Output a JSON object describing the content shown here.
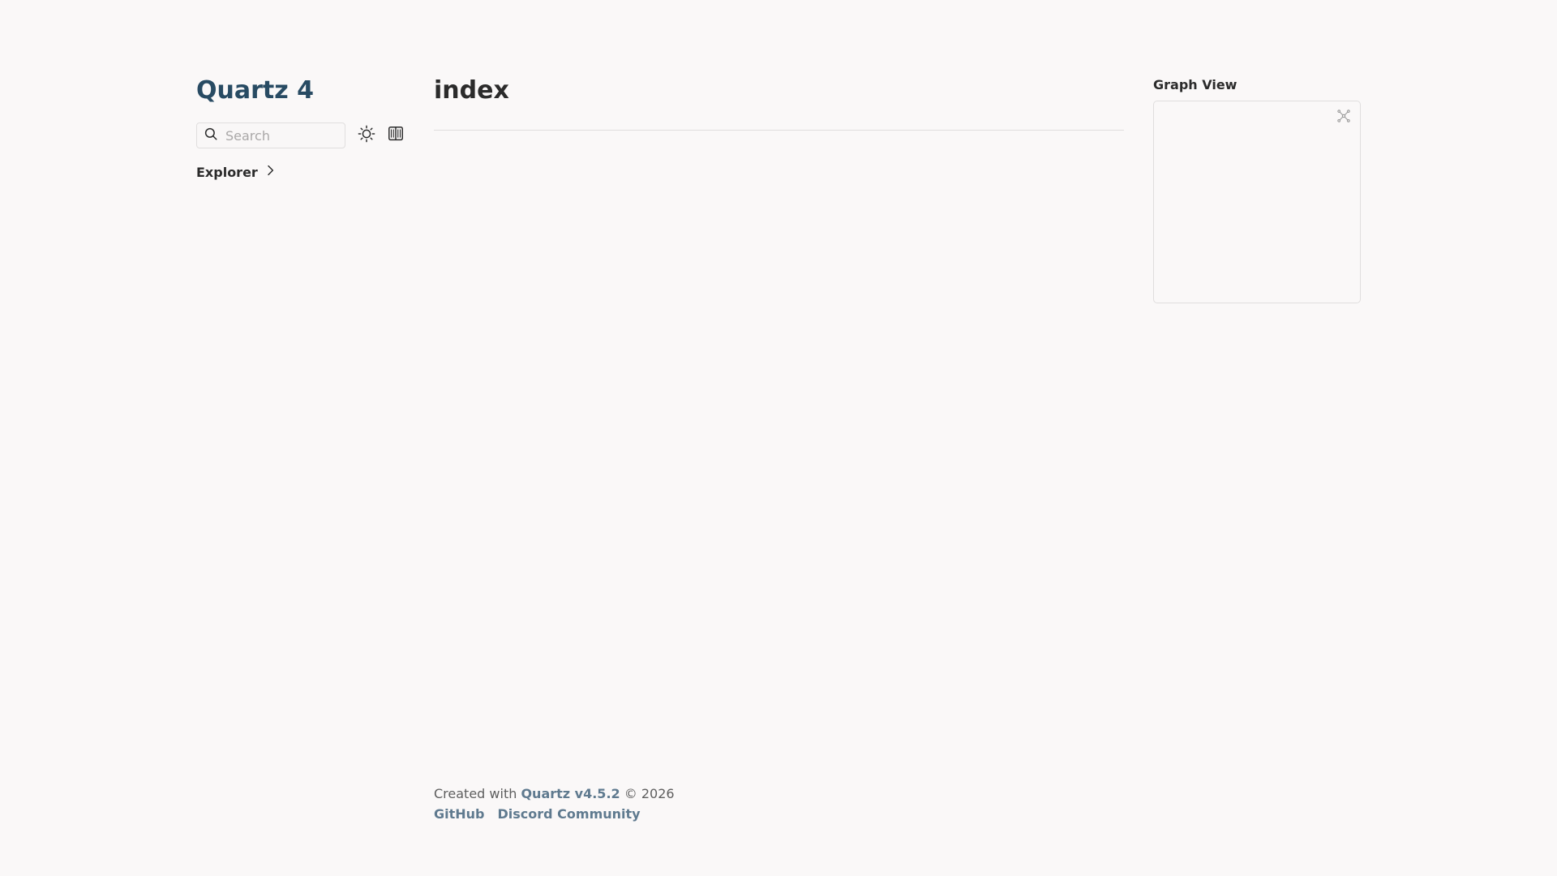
{
  "site": {
    "title": "Quartz 4"
  },
  "search": {
    "placeholder": "Search"
  },
  "explorer": {
    "label": "Explorer"
  },
  "page": {
    "title": "index"
  },
  "graph": {
    "title": "Graph View"
  },
  "footer": {
    "created_with": "Created with",
    "quartz_link": "Quartz v4.5.2",
    "copyright": "© 2026",
    "links": [
      "GitHub",
      "Discord Community"
    ]
  },
  "icons": {
    "search": "search-icon",
    "theme": "sun-icon",
    "reader": "book-open-icon",
    "explorer": "chevron-right-icon",
    "graph": "global-graph-icon"
  },
  "colors": {
    "background": "#faf8f8",
    "title": "#284b63",
    "link": "#5f7a8f",
    "border": "#e0dede"
  }
}
